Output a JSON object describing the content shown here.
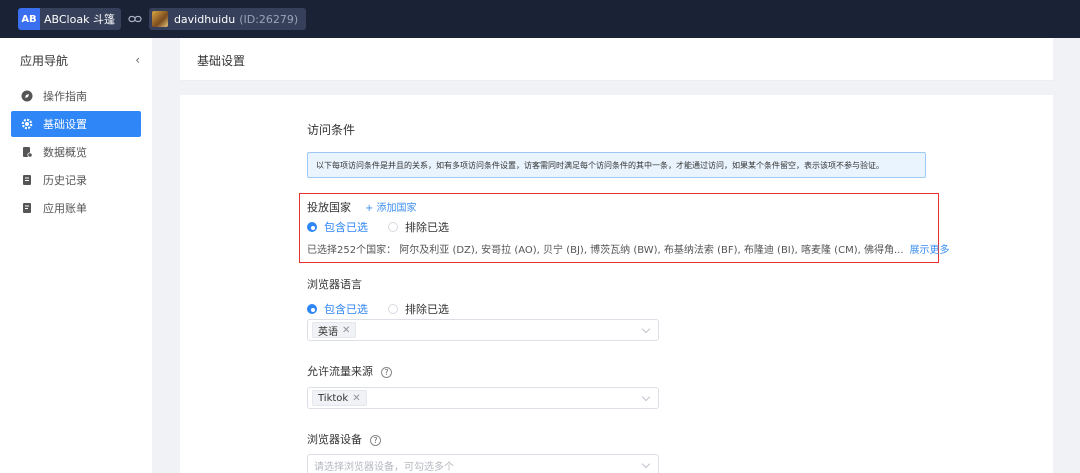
{
  "topbar": {
    "app_badge": "AB",
    "app_name": "ABCloak 斗篷",
    "user_name": "davidhuidu",
    "user_id": "(ID:26279)"
  },
  "sidebar": {
    "title": "应用导航",
    "items": [
      {
        "label": "操作指南",
        "icon": "compass-icon"
      },
      {
        "label": "基础设置",
        "icon": "gear-icon",
        "active": true
      },
      {
        "label": "数据概览",
        "icon": "chart-doc-icon"
      },
      {
        "label": "历史记录",
        "icon": "history-doc-icon"
      },
      {
        "label": "应用账单",
        "icon": "bill-doc-icon"
      }
    ]
  },
  "header": {
    "title": "基础设置"
  },
  "main": {
    "section_title": "访问条件",
    "alert_text": "以下每项访问条件是并且的关系，如有多项访问条件设置，访客需同时满足每个访问条件的其中一条，才能通过访问，如果某个条件留空，表示该项不参与验证。",
    "country": {
      "label": "投放国家",
      "add_link": "+ 添加国家",
      "include_label": "包含已选",
      "exclude_label": "排除已选",
      "summary": "已选择252个国家：  阿尔及利亚 (DZ), 安哥拉 (AO), 贝宁 (BJ), 博茨瓦纳 (BW), 布基纳法索 (BF), 布隆迪 (BI), 喀麦隆 (CM), 佛得角...",
      "show_more": "展示更多"
    },
    "language": {
      "label": "浏览器语言",
      "include_label": "包含已选",
      "exclude_label": "排除已选",
      "tag": "英语"
    },
    "traffic": {
      "label": "允许流量来源",
      "tag": "Tiktok"
    },
    "device": {
      "label": "浏览器设备",
      "placeholder": "请选择浏览器设备，可勾选多个"
    }
  },
  "colors": {
    "topbar_bg": "#1a2236",
    "accent": "#2f86f6",
    "highlight_border": "#e8322f"
  }
}
